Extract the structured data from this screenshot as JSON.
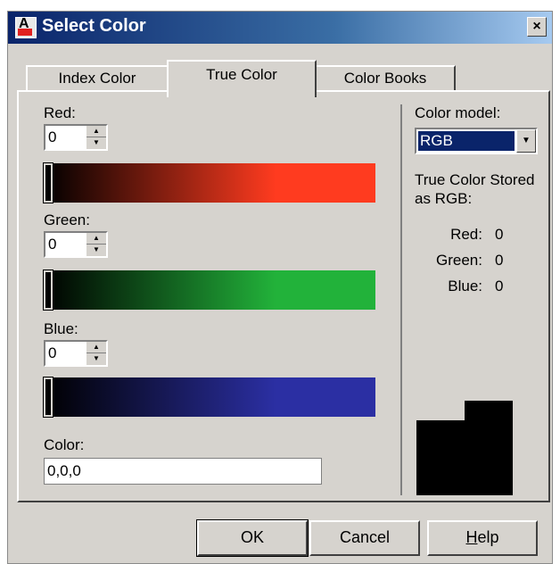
{
  "window": {
    "title": "Select Color",
    "close_glyph": "×",
    "app_icon_letter": "A"
  },
  "tabs": [
    {
      "label": "Index Color",
      "active": false
    },
    {
      "label": "True Color",
      "active": true
    },
    {
      "label": "Color Books",
      "active": false
    }
  ],
  "channels": {
    "red": {
      "label": "Red:",
      "value": "0",
      "gradient": [
        "#000000",
        "#ff3b1f"
      ]
    },
    "green": {
      "label": "Green:",
      "value": "0",
      "gradient": [
        "#000000",
        "#22b23a"
      ]
    },
    "blue": {
      "label": "Blue:",
      "value": "0",
      "gradient": [
        "#000000",
        "#2b2fa3"
      ]
    }
  },
  "color_field": {
    "label": "Color:",
    "value": "0,0,0"
  },
  "color_model": {
    "label": "Color model:",
    "selected": "RGB"
  },
  "stored_info": {
    "text": "True Color Stored as RGB:",
    "rows": [
      {
        "key": "Red:",
        "value": "0"
      },
      {
        "key": "Green:",
        "value": "0"
      },
      {
        "key": "Blue:",
        "value": "0"
      }
    ]
  },
  "preview_color": "#000000",
  "buttons": {
    "ok": "OK",
    "cancel": "Cancel",
    "help": "Help"
  }
}
